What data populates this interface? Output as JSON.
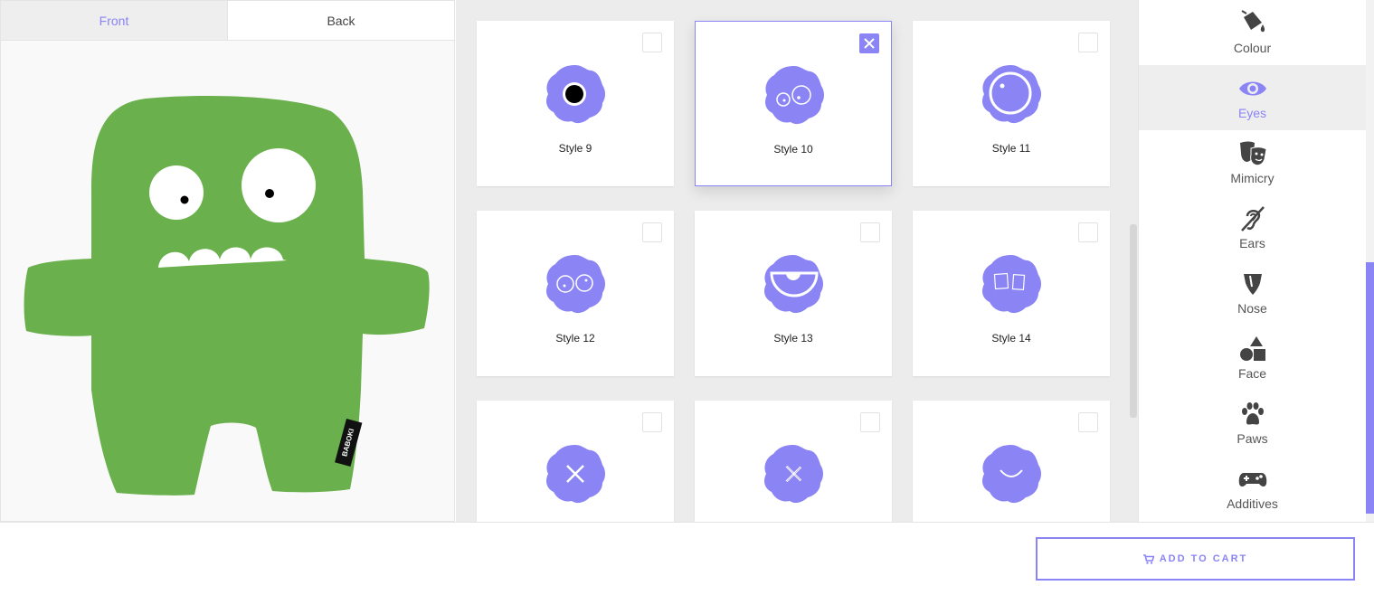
{
  "tabs": [
    {
      "label": "Front",
      "active": true
    },
    {
      "label": "Back",
      "active": false
    }
  ],
  "preview": {
    "tag_text": "BABOKI",
    "body_color": "#6ab04c"
  },
  "styles": [
    {
      "label": "Style 9",
      "selected": false,
      "icon": "pupil-eye"
    },
    {
      "label": "Style 10",
      "selected": true,
      "icon": "two-small-eyes"
    },
    {
      "label": "Style 11",
      "selected": false,
      "icon": "big-ring-eye"
    },
    {
      "label": "Style 12",
      "selected": false,
      "icon": "goggle-eyes"
    },
    {
      "label": "Style 13",
      "selected": false,
      "icon": "half-moon-eye"
    },
    {
      "label": "Style 14",
      "selected": false,
      "icon": "square-eyes"
    },
    {
      "label": "",
      "selected": false,
      "icon": "x-eye"
    },
    {
      "label": "",
      "selected": false,
      "icon": "thin-x-eye"
    },
    {
      "label": "",
      "selected": false,
      "icon": "smile-eye"
    }
  ],
  "sidebar": {
    "items": [
      {
        "label": "Colour",
        "icon": "paint-bucket-icon",
        "active": false
      },
      {
        "label": "Eyes",
        "icon": "eye-icon",
        "active": true
      },
      {
        "label": "Mimicry",
        "icon": "theater-masks-icon",
        "active": false
      },
      {
        "label": "Ears",
        "icon": "ear-icon",
        "active": false
      },
      {
        "label": "Nose",
        "icon": "nose-icon",
        "active": false
      },
      {
        "label": "Face",
        "icon": "shapes-icon",
        "active": false
      },
      {
        "label": "Paws",
        "icon": "paw-icon",
        "active": false
      },
      {
        "label": "Additives",
        "icon": "gamepad-icon",
        "active": false
      }
    ]
  },
  "footer": {
    "add_to_cart": "ADD TO CART"
  },
  "colors": {
    "accent": "#8a84f5",
    "monster": "#6ab04c"
  }
}
